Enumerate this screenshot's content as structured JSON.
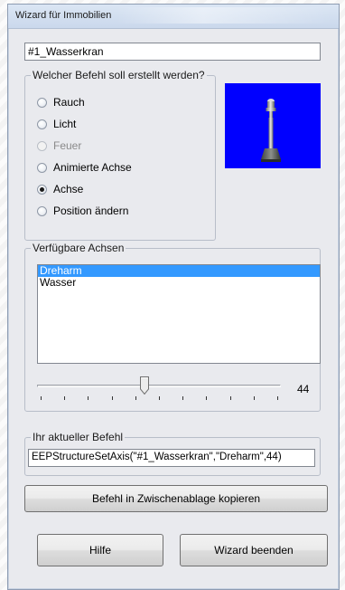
{
  "window": {
    "title": "Wizard für Immobilien"
  },
  "name_field": {
    "value": "#1_Wasserkran"
  },
  "command_group": {
    "legend": "Welcher Befehl soll erstellt werden?",
    "options": [
      {
        "label": "Rauch",
        "checked": false,
        "enabled": true
      },
      {
        "label": "Licht",
        "checked": false,
        "enabled": true
      },
      {
        "label": "Feuer",
        "checked": false,
        "enabled": false
      },
      {
        "label": "Animierte Achse",
        "checked": false,
        "enabled": true
      },
      {
        "label": "Achse",
        "checked": true,
        "enabled": true
      },
      {
        "label": "Position ändern",
        "checked": false,
        "enabled": true
      }
    ]
  },
  "preview": {
    "background_color": "#0000ff",
    "icon": "crane-pole-icon"
  },
  "axes_group": {
    "legend": "Verfügbare Achsen",
    "items": [
      {
        "label": "Dreharm",
        "selected": true
      },
      {
        "label": "Wasser",
        "selected": false
      }
    ]
  },
  "slider": {
    "value": "44",
    "fraction": 0.44
  },
  "current_command_group": {
    "legend": "Ihr aktueller Befehl",
    "value": "EEPStructureSetAxis(\"#1_Wasserkran\",\"Dreharm\",44)"
  },
  "buttons": {
    "copy": "Befehl in Zwischenablage kopieren",
    "help": "Hilfe",
    "close": "Wizard beenden"
  },
  "colors": {
    "selection": "#3399ff",
    "window_bg": "#e9eaee"
  }
}
